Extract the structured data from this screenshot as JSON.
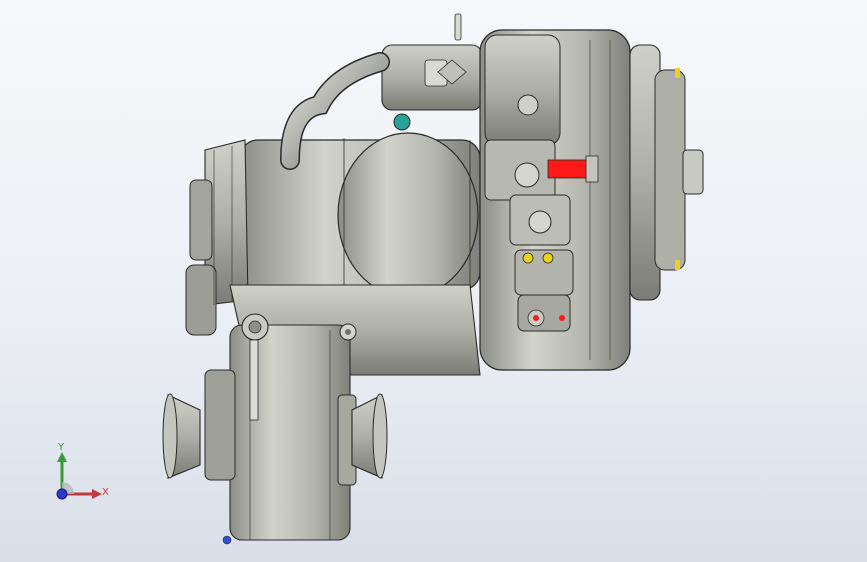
{
  "viewport": {
    "background_top": "#f7f8fb",
    "background_bottom": "#d9dee8"
  },
  "model": {
    "part_color": "#b9bbb1",
    "edge_color": "#2a2a2a",
    "highlight_color": "#ff1a1a",
    "fitting_color": "#2aa39a",
    "marker_color": "#e8d21a"
  },
  "triad": {
    "x_label": "X",
    "y_label": "Y",
    "x_color": "#c23a3a",
    "y_color": "#3a9a3a",
    "z_color": "#2a3acb"
  }
}
